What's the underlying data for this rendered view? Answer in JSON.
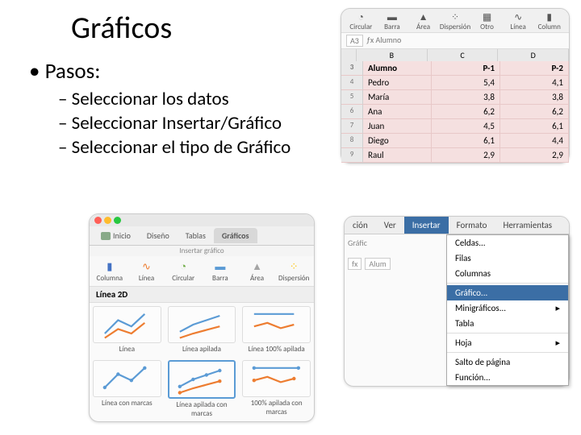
{
  "title": "Gráficos",
  "bullet": "Pasos:",
  "steps": [
    "Seleccionar los datos",
    "Seleccionar Insertar/Gráfico",
    "Seleccionar el tipo de Gráfico"
  ],
  "dataShot": {
    "ribbon": [
      "Circular",
      "Barra",
      "Área",
      "Dispersión",
      "Otro",
      "Línea",
      "Column"
    ],
    "ribbonIcons": [
      "◔",
      "▬",
      "▲",
      "⁘",
      "▦",
      "∿",
      "▮"
    ],
    "activeCell": "A3",
    "fxValue": "Alumno",
    "cols": [
      "",
      "B",
      "C",
      "D"
    ],
    "header": [
      "Alumno",
      "P-1",
      "P-2"
    ],
    "rows": [
      {
        "n": "4",
        "name": "Pedro",
        "p1": "5,4",
        "p2": "4,1"
      },
      {
        "n": "5",
        "name": "María",
        "p1": "3,8",
        "p2": "3,8"
      },
      {
        "n": "6",
        "name": "Ana",
        "p1": "6,2",
        "p2": "6,2"
      },
      {
        "n": "7",
        "name": "Juan",
        "p1": "4,5",
        "p2": "6,1"
      },
      {
        "n": "8",
        "name": "Diego",
        "p1": "6,1",
        "p2": "4,4"
      },
      {
        "n": "9",
        "name": "Raul",
        "p1": "2,9",
        "p2": "2,9"
      }
    ]
  },
  "gallery": {
    "tabs": [
      "Inicio",
      "Diseño",
      "Tablas",
      "Gráficos"
    ],
    "activeTab": "Gráficos",
    "insertLabel": "Insertar gráfico",
    "chartTypes": [
      {
        "label": "Columna",
        "icon": "▮"
      },
      {
        "label": "Línea",
        "icon": "∿"
      },
      {
        "label": "Circular",
        "icon": "◔"
      },
      {
        "label": "Barra",
        "icon": "▬"
      },
      {
        "label": "Área",
        "icon": "▲"
      },
      {
        "label": "Dispersión",
        "icon": "⁘"
      }
    ],
    "group": "Línea 2D",
    "options": [
      "Línea",
      "Línea apilada",
      "Línea 100% apilada",
      "Línea con marcas",
      "Línea apilada con marcas",
      "100% apilada con marcas"
    ],
    "selected": 4
  },
  "menu": {
    "bar": [
      "ción",
      "Ver",
      "Insertar",
      "Formato",
      "Herramientas"
    ],
    "open": "Insertar",
    "items": [
      "Celdas...",
      "Filas",
      "Columnas",
      "---",
      "Gráfico...",
      "Minigráficos...",
      "Tabla",
      "---",
      "Hoja",
      "---",
      "Salto de página",
      "Función..."
    ],
    "highlight": "Gráfico...",
    "under": {
      "tab": "Gráfic",
      "cell": "fx",
      "val": "Alum"
    }
  },
  "chart_data": {
    "type": "table",
    "title": "Alumno P-1 P-2",
    "columns": [
      "Alumno",
      "P-1",
      "P-2"
    ],
    "rows": [
      [
        "Pedro",
        5.4,
        4.1
      ],
      [
        "María",
        3.8,
        3.8
      ],
      [
        "Ana",
        6.2,
        6.2
      ],
      [
        "Juan",
        4.5,
        6.1
      ],
      [
        "Diego",
        6.1,
        4.4
      ],
      [
        "Raul",
        2.9,
        2.9
      ]
    ]
  }
}
